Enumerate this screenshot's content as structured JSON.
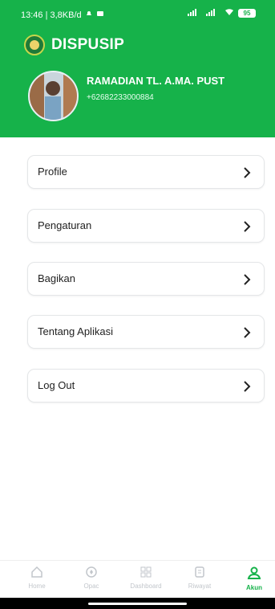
{
  "status": {
    "time_info": "13:46 | 3,8KB/d",
    "battery": "95"
  },
  "brand": {
    "name": "DISPUSIP"
  },
  "user": {
    "name": "RAMADIAN TL. A.MA. PUST",
    "phone": "+62682233000884"
  },
  "menu": [
    {
      "label": "Profile"
    },
    {
      "label": "Pengaturan"
    },
    {
      "label": "Bagikan"
    },
    {
      "label": "Tentang Aplikasi"
    },
    {
      "label": "Log Out"
    }
  ],
  "bottom_nav": [
    {
      "label": "Home",
      "icon": "home-icon"
    },
    {
      "label": "Opac",
      "icon": "compass-icon"
    },
    {
      "label": "Dashboard",
      "icon": "dashboard-icon"
    },
    {
      "label": "Riwayat",
      "icon": "history-icon"
    },
    {
      "label": "Akun",
      "icon": "user-icon",
      "active": true
    }
  ],
  "colors": {
    "primary": "#16b24a",
    "inactive": "#c2c6cb"
  }
}
